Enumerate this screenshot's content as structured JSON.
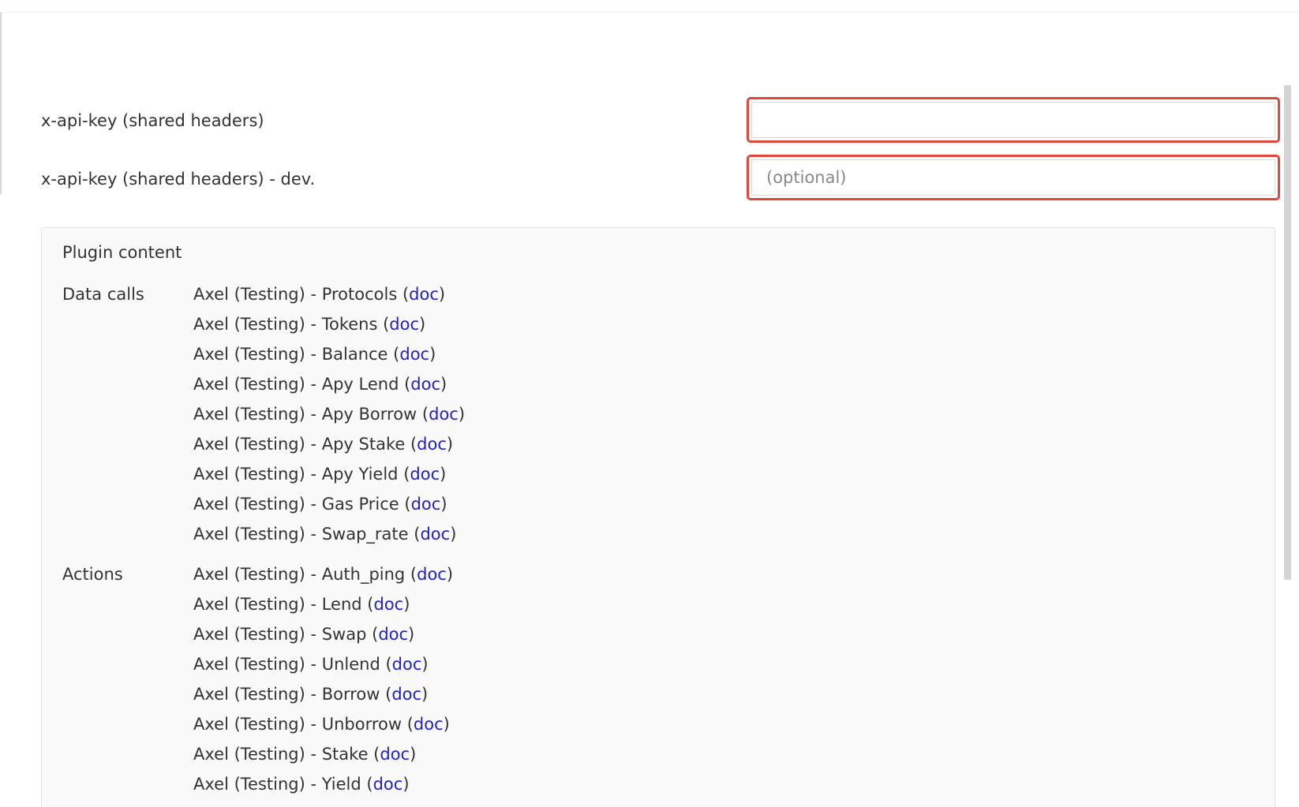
{
  "fields": [
    {
      "label": "x-api-key (shared headers)",
      "value": "",
      "placeholder": ""
    },
    {
      "label": "x-api-key (shared headers) - dev.",
      "value": "",
      "placeholder": "(optional)"
    }
  ],
  "plugin": {
    "title": "Plugin content",
    "sections": [
      {
        "label": "Data calls",
        "items": [
          {
            "name": "Axel (Testing) - Protocols",
            "link": "doc"
          },
          {
            "name": "Axel (Testing) - Tokens",
            "link": "doc"
          },
          {
            "name": "Axel (Testing) - Balance",
            "link": "doc"
          },
          {
            "name": "Axel (Testing) - Apy Lend",
            "link": "doc"
          },
          {
            "name": "Axel (Testing) - Apy Borrow",
            "link": "doc"
          },
          {
            "name": "Axel (Testing) - Apy Stake",
            "link": "doc"
          },
          {
            "name": "Axel (Testing) - Apy Yield",
            "link": "doc"
          },
          {
            "name": "Axel (Testing) - Gas Price",
            "link": "doc"
          },
          {
            "name": "Axel (Testing) - Swap_rate",
            "link": "doc"
          }
        ]
      },
      {
        "label": "Actions",
        "items": [
          {
            "name": "Axel (Testing) - Auth_ping",
            "link": "doc"
          },
          {
            "name": "Axel (Testing) - Lend",
            "link": "doc"
          },
          {
            "name": "Axel (Testing) - Swap",
            "link": "doc"
          },
          {
            "name": "Axel (Testing) - Unlend",
            "link": "doc"
          },
          {
            "name": "Axel (Testing) - Borrow",
            "link": "doc"
          },
          {
            "name": "Axel (Testing) - Unborrow",
            "link": "doc"
          },
          {
            "name": "Axel (Testing) - Stake",
            "link": "doc"
          },
          {
            "name": "Axel (Testing) - Yield",
            "link": "doc"
          }
        ]
      }
    ]
  },
  "colors": {
    "error_border": "#e0463a",
    "link": "#2121c4",
    "panel_background": "#f9f9f9"
  }
}
